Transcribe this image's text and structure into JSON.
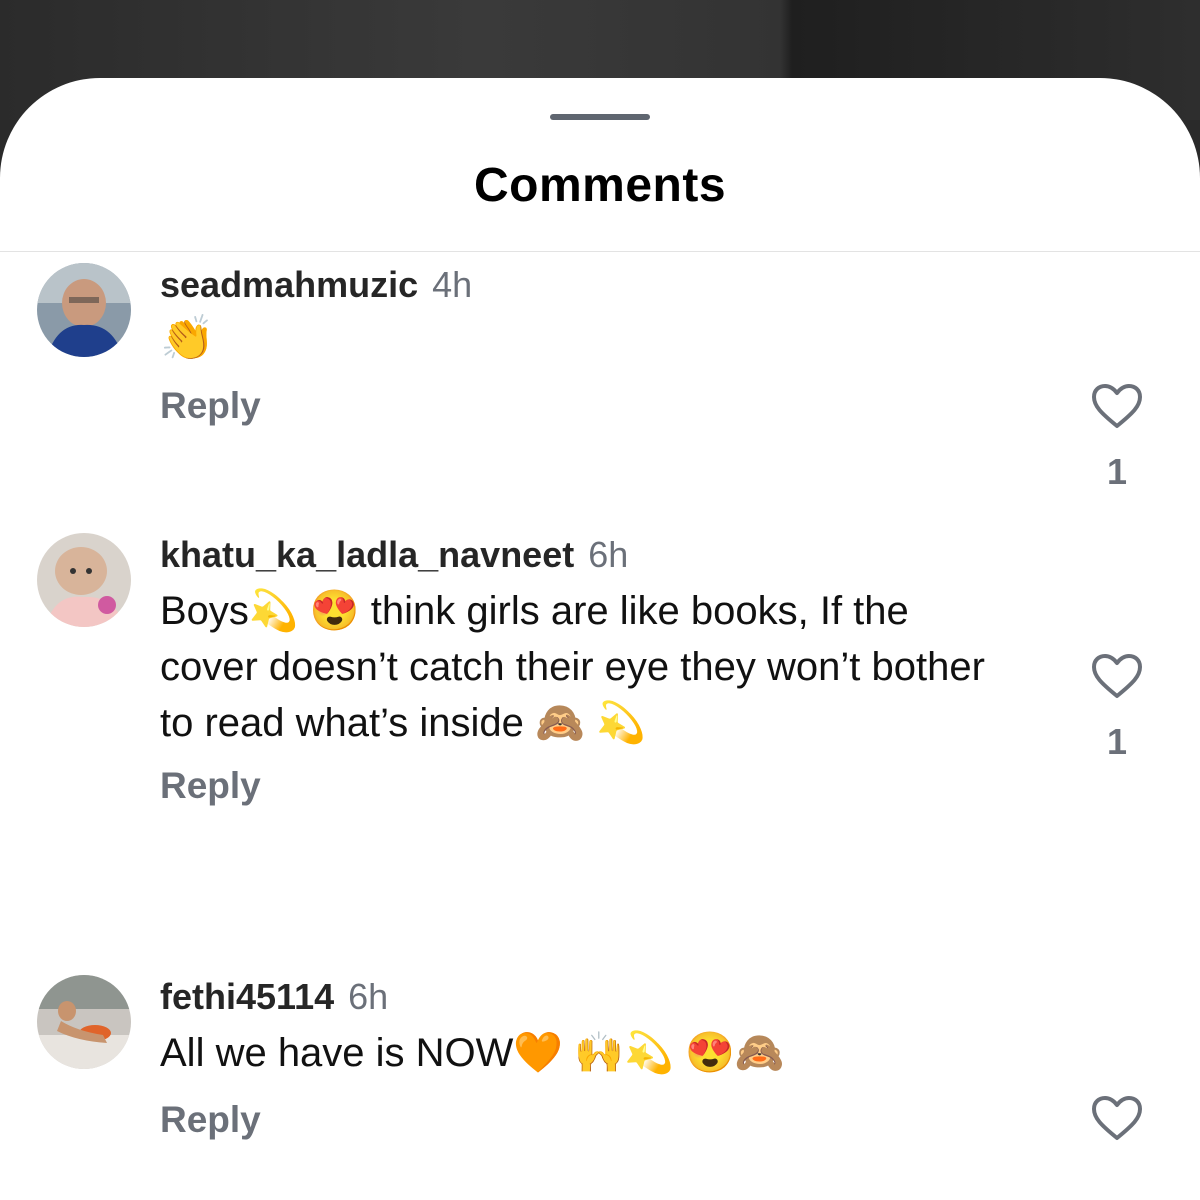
{
  "sheet": {
    "title": "Comments"
  },
  "comments": [
    {
      "username": "seadmahmuzic",
      "time": "4h",
      "text": "👏",
      "reply_label": "Reply",
      "like_count": "1"
    },
    {
      "username": "khatu_ka_ladla_navneet",
      "time": "6h",
      "text": "Boys💫 😍 think girls are like books, If the cover doesn’t catch their eye they won’t bother to read what’s inside 🙈 💫",
      "reply_label": "Reply",
      "like_count": "1"
    },
    {
      "username": "fethi45114",
      "time": "6h",
      "text": "All we have is NOW🧡 🙌💫 😍🙈",
      "reply_label": "Reply",
      "like_count": ""
    }
  ],
  "icons": {
    "like": "heart-outline-icon",
    "grabber": "drag-handle"
  },
  "colors": {
    "secondary_text": "#6b7079",
    "primary_text": "#000000",
    "sheet_background": "#ffffff"
  }
}
